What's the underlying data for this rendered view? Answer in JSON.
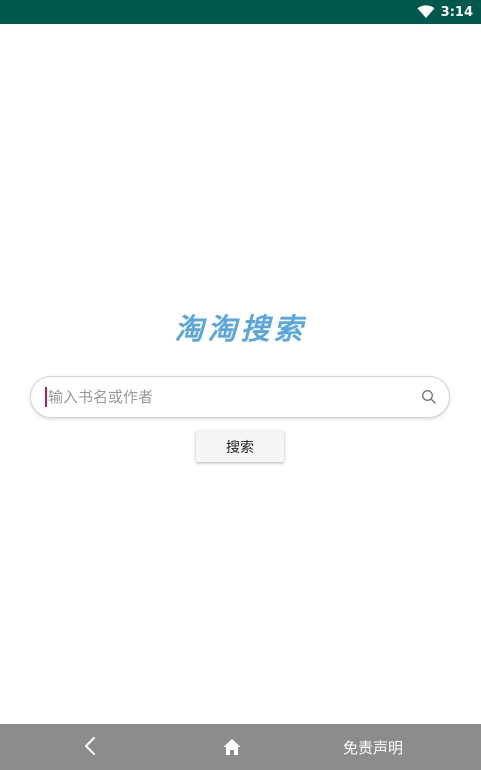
{
  "status_bar": {
    "time": "3:14",
    "icons": [
      "wifi-icon",
      "battery-icon"
    ],
    "background_color": "#00574b"
  },
  "logo": {
    "text": "淘淘搜索",
    "color": "#5aa7de"
  },
  "search": {
    "placeholder": "输入书名或作者",
    "value": "",
    "icon": "search-icon"
  },
  "search_button": {
    "label": "搜索"
  },
  "bottom_nav": {
    "back_icon": "back-chevron-icon",
    "home_icon": "home-icon",
    "disclaimer_label": "免责声明",
    "background_color": "#8c8c8c"
  },
  "colors": {
    "accent": "#5aa7de",
    "cursor": "#c2185b"
  }
}
